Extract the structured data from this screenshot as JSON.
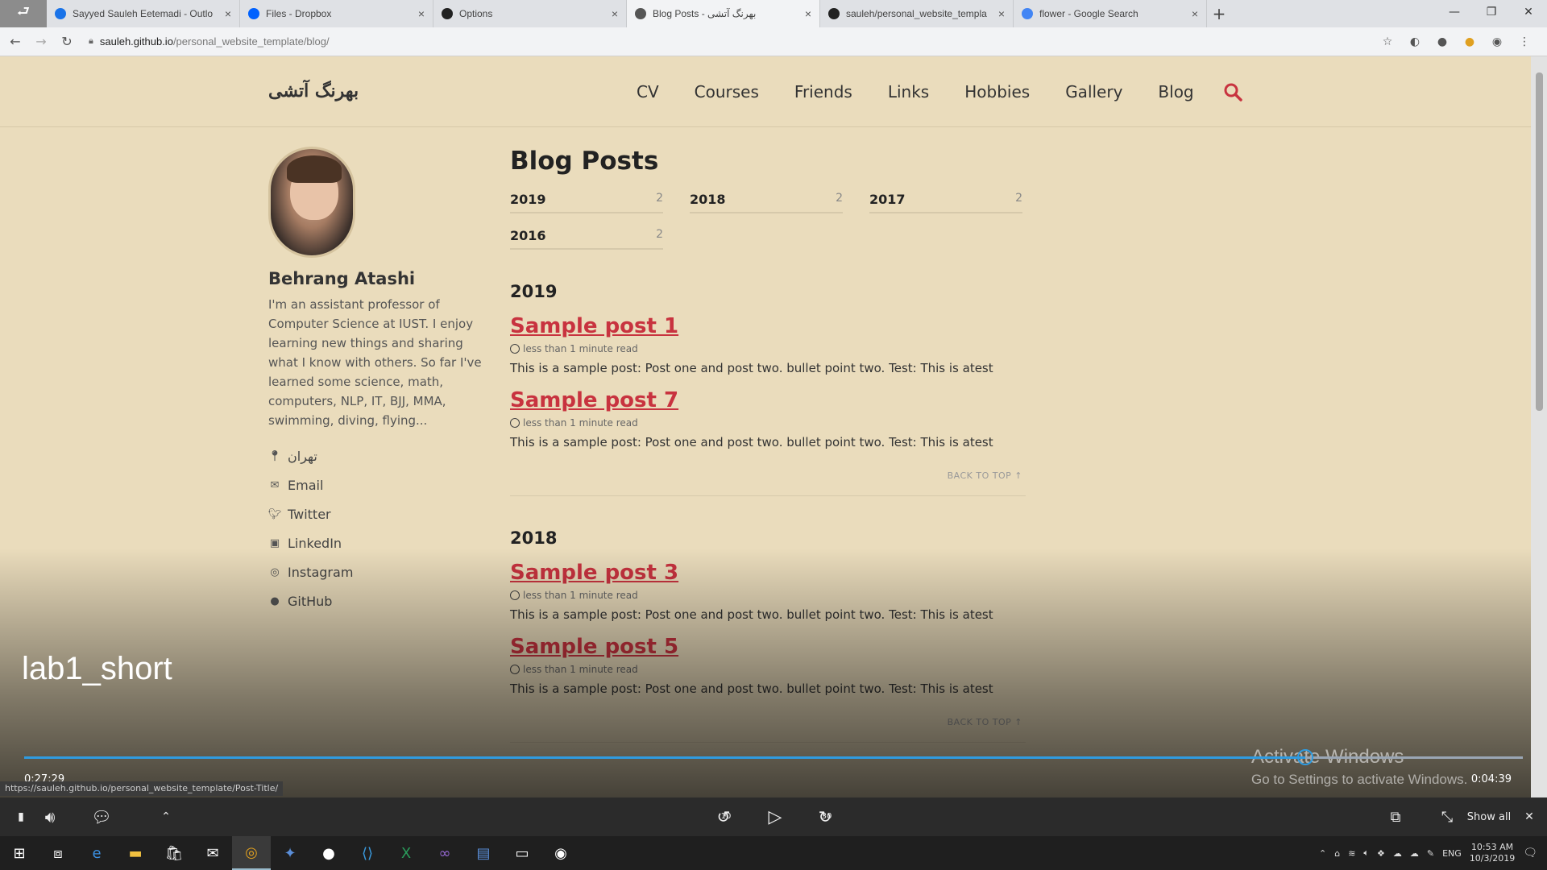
{
  "browser": {
    "tabs": [
      {
        "label": "Sayyed Sauleh Eetemadi - Outlo",
        "fav_color": "#1a73e8",
        "active": false
      },
      {
        "label": "Files - Dropbox",
        "fav_color": "#0061fe",
        "active": false
      },
      {
        "label": "Options",
        "fav_color": "#222222",
        "active": false
      },
      {
        "label": "Blog Posts - بهرنگ آتشی",
        "fav_color": "#555555",
        "active": true
      },
      {
        "label": "sauleh/personal_website_templa",
        "fav_color": "#222222",
        "active": false
      },
      {
        "label": "flower - Google Search",
        "fav_color": "#4285f4",
        "active": false
      }
    ],
    "url_host": "sauleh.github.io",
    "url_path": "/personal_website_template/blog/"
  },
  "site": {
    "title": "بهرنگ آتشی",
    "nav": [
      "CV",
      "Courses",
      "Friends",
      "Links",
      "Hobbies",
      "Gallery",
      "Blog"
    ],
    "accent": "#c8333f"
  },
  "author": {
    "name": "Behrang Atashi",
    "bio": "I'm an assistant professor of Computer Science at IUST. I enjoy learning new things and sharing what I know with others. So far I've learned some science, math, computers, NLP, IT, BJJ, MMA, swimming, diving, flying...",
    "location": "تهران",
    "links": [
      {
        "icon": "email-icon",
        "label": "Email"
      },
      {
        "icon": "twitter-icon",
        "label": "Twitter"
      },
      {
        "icon": "linkedin-icon",
        "label": "LinkedIn"
      },
      {
        "icon": "instagram-icon",
        "label": "Instagram"
      },
      {
        "icon": "github-icon",
        "label": "GitHub"
      }
    ]
  },
  "blog": {
    "heading": "Blog Posts",
    "years": [
      {
        "year": "2019",
        "count": "2"
      },
      {
        "year": "2018",
        "count": "2"
      },
      {
        "year": "2017",
        "count": "2"
      },
      {
        "year": "2016",
        "count": "2"
      }
    ],
    "sections": [
      {
        "year": "2019",
        "posts": [
          {
            "title": "Sample post 1",
            "meta": "less than 1 minute read",
            "excerpt": "This is a sample post: Post one and post two. bullet point two. Test: This is atest"
          },
          {
            "title": "Sample post 7",
            "meta": "less than 1 minute read",
            "excerpt": "This is a sample post: Post one and post two. bullet point two. Test: This is atest"
          }
        ],
        "back_to_top": "BACK TO TOP ↑"
      },
      {
        "year": "2018",
        "posts": [
          {
            "title": "Sample post 3",
            "meta": "less than 1 minute read",
            "excerpt": "This is a sample post: Post one and post two. bullet point two. Test: This is atest"
          },
          {
            "title": "Sample post 5",
            "meta": "less than 1 minute read",
            "excerpt": "This is a sample post: Post one and post two. bullet point two. Test: This is atest"
          }
        ],
        "back_to_top": "BACK TO TOP ↑"
      }
    ]
  },
  "video": {
    "title": "lab1_short",
    "current_time": "0:27:29",
    "total_time": "0:04:39",
    "progress": 0.855,
    "status_url": "https://sauleh.github.io/personal_website_template/Post-Title/",
    "activate_line1": "Activate Windows",
    "activate_line2": "Go to Settings to activate Windows.",
    "rewind_label": "10",
    "forward_label": "30",
    "show_all": "Show all"
  },
  "taskbar": {
    "lang": "ENG",
    "time": "10:53 AM",
    "date": "10/3/2019"
  }
}
